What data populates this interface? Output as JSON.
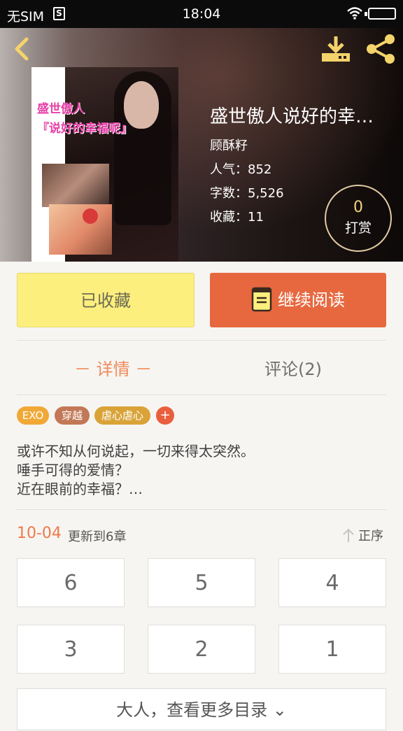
{
  "status_bar": {
    "carrier": "无SIM",
    "sim_icon_label": "S",
    "time": "18:04"
  },
  "book": {
    "cover_title_line1": "盛世傲人",
    "cover_title_line2": "『说好的幸福呢』",
    "title": "盛世傲人说好的幸…",
    "author": "顾酥籽",
    "popularity": "人气：852",
    "word_count": "字数：5,526",
    "favorites": "收藏：11"
  },
  "tip": {
    "count": "0",
    "label": "打赏"
  },
  "actions": {
    "favorited_label": "已收藏",
    "continue_reading_label": "继续阅读"
  },
  "tabs": {
    "details": "－ 详情 －",
    "comments": "评论(2)"
  },
  "tags": [
    {
      "label": "EXO",
      "color": "#f0a936"
    },
    {
      "label": "穿越",
      "color": "#c27856"
    },
    {
      "label": "虐心虐心",
      "color": "#d9a338"
    },
    {
      "label": "+",
      "color": "#e95f3e"
    }
  ],
  "description": [
    "或许不知从何说起，一切来得太突然。",
    "唾手可得的爱情？",
    "近在眼前的幸福？…"
  ],
  "update": {
    "date": "10-04",
    "text": "更新到6章",
    "sort_label": "正序"
  },
  "chapters": [
    "6",
    "5",
    "4",
    "3",
    "2",
    "1"
  ],
  "more_catalog_label": "大人，查看更多目录 ⌄",
  "colors": {
    "accent_orange": "#e7683f",
    "favorited_yellow": "#fcef7d",
    "tip_gold": "#e2c9a3"
  }
}
